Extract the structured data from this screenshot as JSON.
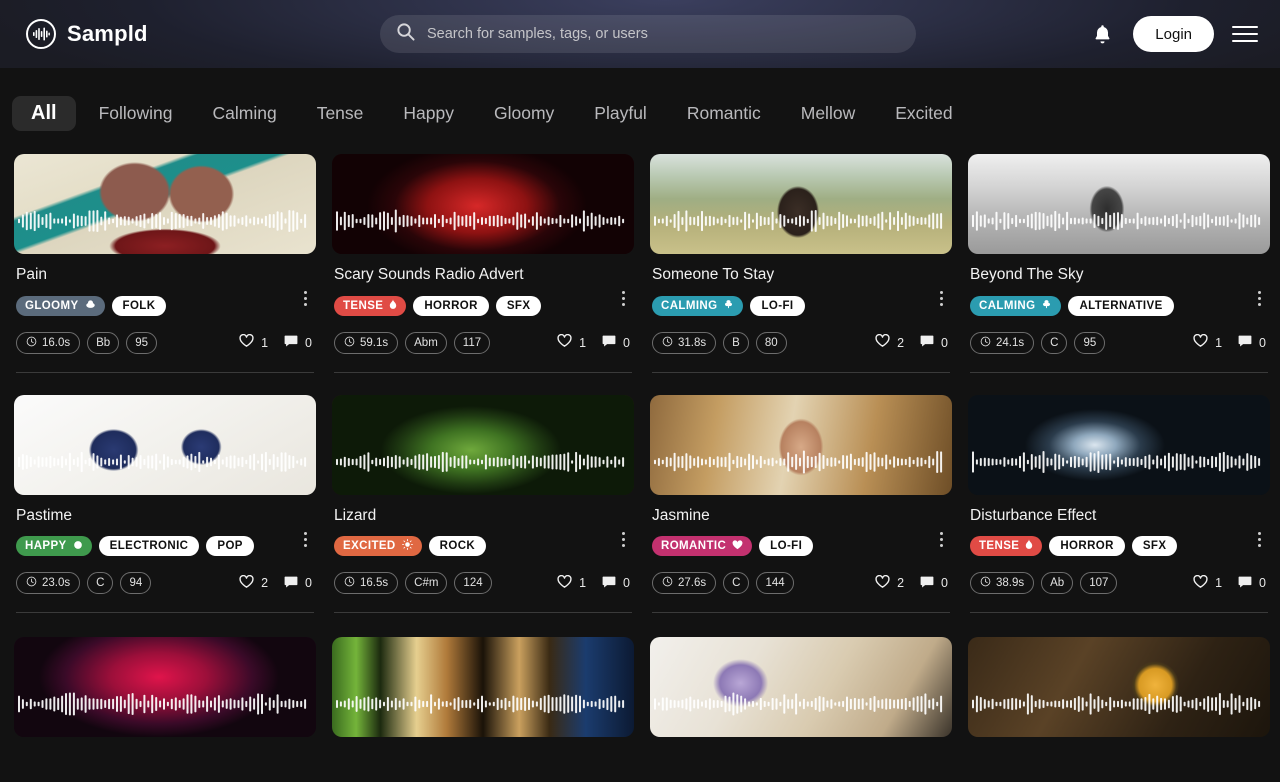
{
  "header": {
    "brand_name": "Sampld",
    "brand_icon": "waveform-circle-icon",
    "search_placeholder": "Search for samples, tags, or users",
    "search_value": "",
    "search_icon": "search-icon",
    "notification_icon": "bell-icon",
    "login_label": "Login",
    "menu_icon": "hamburger-menu-icon",
    "gradient_start": "#1a1b22",
    "gradient_mid": "#33364f"
  },
  "filters": {
    "active": "All",
    "items": [
      {
        "label": "All",
        "active": true
      },
      {
        "label": "Following",
        "active": false
      },
      {
        "label": "Calming",
        "active": false
      },
      {
        "label": "Tense",
        "active": false
      },
      {
        "label": "Happy",
        "active": false
      },
      {
        "label": "Gloomy",
        "active": false
      },
      {
        "label": "Playful",
        "active": false
      },
      {
        "label": "Romantic",
        "active": false
      },
      {
        "label": "Mellow",
        "active": false
      },
      {
        "label": "Excited",
        "active": false
      }
    ]
  },
  "mood_colors": {
    "GLOOMY": "#5b6b7c",
    "TENSE": "#e04b45",
    "CALMING": "#2b9cb0",
    "HAPPY": "#3f9a4d",
    "EXCITED": "#e06842",
    "ROMANTIC": "#c3316f"
  },
  "cards": [
    {
      "title": "Pain",
      "mood": "GLOOMY",
      "mood_icon": "cloud-icon",
      "genres": [
        "FOLK"
      ],
      "duration": "16.0s",
      "key": "Bb",
      "bpm": "95",
      "likes": "1",
      "comments": "0",
      "thumb_style": "pain",
      "clock_icon": "clock-icon",
      "like_icon": "heart-icon",
      "comment_icon": "comment-icon",
      "more_icon": "kebab-menu-icon"
    },
    {
      "title": "Scary Sounds Radio Advert",
      "mood": "TENSE",
      "mood_icon": "fire-drop-icon",
      "genres": [
        "HORROR",
        "SFX"
      ],
      "duration": "59.1s",
      "key": "Abm",
      "bpm": "117",
      "likes": "1",
      "comments": "0",
      "thumb_style": "scary",
      "clock_icon": "clock-icon",
      "like_icon": "heart-icon",
      "comment_icon": "comment-icon",
      "more_icon": "kebab-menu-icon"
    },
    {
      "title": "Someone To Stay",
      "mood": "CALMING",
      "mood_icon": "leaf-icon",
      "genres": [
        "LO-FI"
      ],
      "duration": "31.8s",
      "key": "B",
      "bpm": "80",
      "likes": "2",
      "comments": "0",
      "thumb_style": "field",
      "clock_icon": "clock-icon",
      "like_icon": "heart-icon",
      "comment_icon": "comment-icon",
      "more_icon": "kebab-menu-icon"
    },
    {
      "title": "Beyond The Sky",
      "mood": "CALMING",
      "mood_icon": "leaf-icon",
      "genres": [
        "ALTERNATIVE"
      ],
      "duration": "24.1s",
      "key": "C",
      "bpm": "95",
      "likes": "1",
      "comments": "0",
      "thumb_style": "sky",
      "clock_icon": "clock-icon",
      "like_icon": "heart-icon",
      "comment_icon": "comment-icon",
      "more_icon": "kebab-menu-icon"
    },
    {
      "title": "Pastime",
      "mood": "HAPPY",
      "mood_icon": "circle-dot-icon",
      "genres": [
        "ELECTRONIC",
        "POP"
      ],
      "duration": "23.0s",
      "key": "C",
      "bpm": "94",
      "likes": "2",
      "comments": "0",
      "thumb_style": "yarn",
      "clock_icon": "clock-icon",
      "like_icon": "heart-icon",
      "comment_icon": "comment-icon",
      "more_icon": "kebab-menu-icon"
    },
    {
      "title": "Lizard",
      "mood": "EXCITED",
      "mood_icon": "sun-icon",
      "genres": [
        "ROCK"
      ],
      "duration": "16.5s",
      "key": "C#m",
      "bpm": "124",
      "likes": "1",
      "comments": "0",
      "thumb_style": "lizard",
      "clock_icon": "clock-icon",
      "like_icon": "heart-icon",
      "comment_icon": "comment-icon",
      "more_icon": "kebab-menu-icon"
    },
    {
      "title": "Jasmine",
      "mood": "ROMANTIC",
      "mood_icon": "heart-icon",
      "genres": [
        "LO-FI"
      ],
      "duration": "27.6s",
      "key": "C",
      "bpm": "144",
      "likes": "2",
      "comments": "0",
      "thumb_style": "portrait",
      "clock_icon": "clock-icon",
      "like_icon": "heart-icon",
      "comment_icon": "comment-icon",
      "more_icon": "kebab-menu-icon"
    },
    {
      "title": "Disturbance Effect",
      "mood": "TENSE",
      "mood_icon": "fire-drop-icon",
      "genres": [
        "HORROR",
        "SFX"
      ],
      "duration": "38.9s",
      "key": "Ab",
      "bpm": "107",
      "likes": "1",
      "comments": "0",
      "thumb_style": "smoke",
      "clock_icon": "clock-icon",
      "like_icon": "heart-icon",
      "comment_icon": "comment-icon",
      "more_icon": "kebab-menu-icon"
    }
  ],
  "partial_row": [
    {
      "thumb_style": "concert"
    },
    {
      "thumb_style": "stage"
    },
    {
      "thumb_style": "flowers"
    },
    {
      "thumb_style": "vinyl"
    }
  ]
}
